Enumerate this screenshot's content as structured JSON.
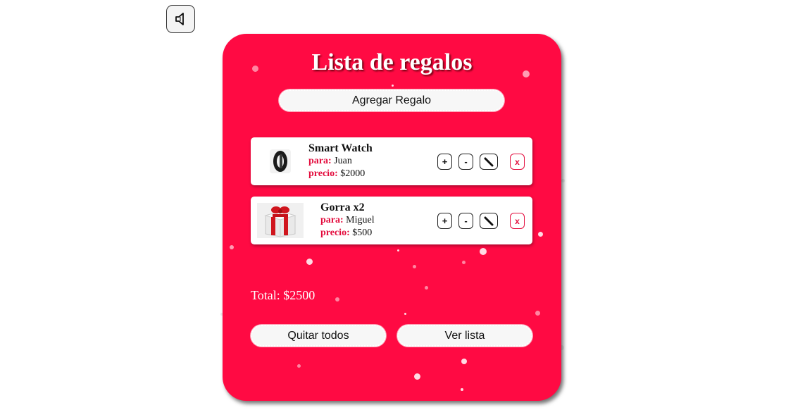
{
  "sound_toggle": {
    "icon": "speaker-icon"
  },
  "gift_list": {
    "title": "Lista de regalos",
    "add_button_label": "Agregar Regalo",
    "items": [
      {
        "name": "Smart Watch",
        "recipient_label": "para:",
        "recipient": "Juan",
        "price_label": "precio:",
        "price": "$2000",
        "thumbnail": "smartwatch-image",
        "controls": {
          "increase": "+",
          "decrease": "-",
          "edit_icon": "pencil-icon",
          "delete": "x"
        }
      },
      {
        "name": "Gorra x2",
        "recipient_label": "para:",
        "recipient": "Miguel",
        "price_label": "precio:",
        "price": "$500",
        "thumbnail": "gift-box-image",
        "controls": {
          "increase": "+",
          "decrease": "-",
          "edit_icon": "pencil-icon",
          "delete": "x"
        }
      }
    ],
    "total_text": "Total: $2500",
    "clear_all_label": "Quitar todos",
    "view_list_label": "Ver lista"
  },
  "colors": {
    "card_background": "#ff0a43",
    "accent_label": "#e30b3c",
    "button_background": "#f7f7f7"
  }
}
